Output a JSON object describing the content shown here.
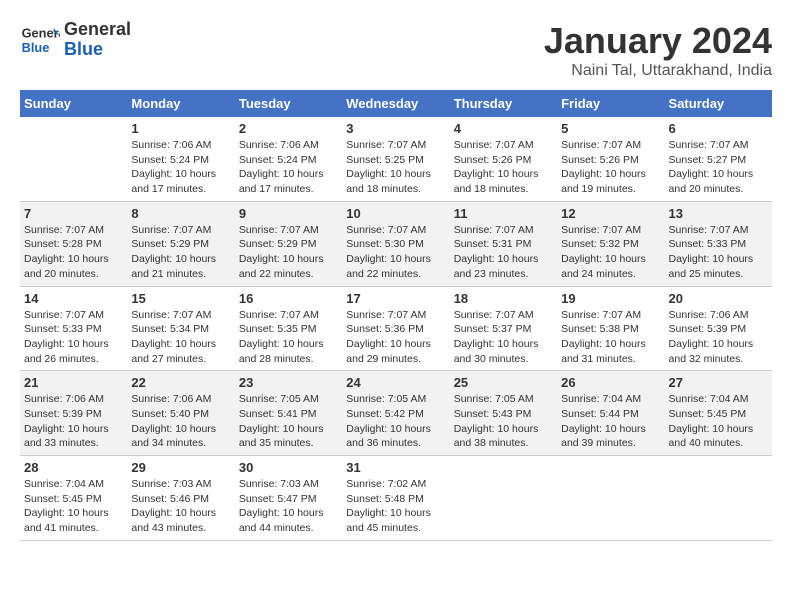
{
  "header": {
    "logo_line1": "General",
    "logo_line2": "Blue",
    "month": "January 2024",
    "location": "Naini Tal, Uttarakhand, India"
  },
  "weekdays": [
    "Sunday",
    "Monday",
    "Tuesday",
    "Wednesday",
    "Thursday",
    "Friday",
    "Saturday"
  ],
  "weeks": [
    [
      {
        "day": "",
        "info": ""
      },
      {
        "day": "1",
        "info": "Sunrise: 7:06 AM\nSunset: 5:24 PM\nDaylight: 10 hours\nand 17 minutes."
      },
      {
        "day": "2",
        "info": "Sunrise: 7:06 AM\nSunset: 5:24 PM\nDaylight: 10 hours\nand 17 minutes."
      },
      {
        "day": "3",
        "info": "Sunrise: 7:07 AM\nSunset: 5:25 PM\nDaylight: 10 hours\nand 18 minutes."
      },
      {
        "day": "4",
        "info": "Sunrise: 7:07 AM\nSunset: 5:26 PM\nDaylight: 10 hours\nand 18 minutes."
      },
      {
        "day": "5",
        "info": "Sunrise: 7:07 AM\nSunset: 5:26 PM\nDaylight: 10 hours\nand 19 minutes."
      },
      {
        "day": "6",
        "info": "Sunrise: 7:07 AM\nSunset: 5:27 PM\nDaylight: 10 hours\nand 20 minutes."
      }
    ],
    [
      {
        "day": "7",
        "info": "Sunrise: 7:07 AM\nSunset: 5:28 PM\nDaylight: 10 hours\nand 20 minutes."
      },
      {
        "day": "8",
        "info": "Sunrise: 7:07 AM\nSunset: 5:29 PM\nDaylight: 10 hours\nand 21 minutes."
      },
      {
        "day": "9",
        "info": "Sunrise: 7:07 AM\nSunset: 5:29 PM\nDaylight: 10 hours\nand 22 minutes."
      },
      {
        "day": "10",
        "info": "Sunrise: 7:07 AM\nSunset: 5:30 PM\nDaylight: 10 hours\nand 22 minutes."
      },
      {
        "day": "11",
        "info": "Sunrise: 7:07 AM\nSunset: 5:31 PM\nDaylight: 10 hours\nand 23 minutes."
      },
      {
        "day": "12",
        "info": "Sunrise: 7:07 AM\nSunset: 5:32 PM\nDaylight: 10 hours\nand 24 minutes."
      },
      {
        "day": "13",
        "info": "Sunrise: 7:07 AM\nSunset: 5:33 PM\nDaylight: 10 hours\nand 25 minutes."
      }
    ],
    [
      {
        "day": "14",
        "info": "Sunrise: 7:07 AM\nSunset: 5:33 PM\nDaylight: 10 hours\nand 26 minutes."
      },
      {
        "day": "15",
        "info": "Sunrise: 7:07 AM\nSunset: 5:34 PM\nDaylight: 10 hours\nand 27 minutes."
      },
      {
        "day": "16",
        "info": "Sunrise: 7:07 AM\nSunset: 5:35 PM\nDaylight: 10 hours\nand 28 minutes."
      },
      {
        "day": "17",
        "info": "Sunrise: 7:07 AM\nSunset: 5:36 PM\nDaylight: 10 hours\nand 29 minutes."
      },
      {
        "day": "18",
        "info": "Sunrise: 7:07 AM\nSunset: 5:37 PM\nDaylight: 10 hours\nand 30 minutes."
      },
      {
        "day": "19",
        "info": "Sunrise: 7:07 AM\nSunset: 5:38 PM\nDaylight: 10 hours\nand 31 minutes."
      },
      {
        "day": "20",
        "info": "Sunrise: 7:06 AM\nSunset: 5:39 PM\nDaylight: 10 hours\nand 32 minutes."
      }
    ],
    [
      {
        "day": "21",
        "info": "Sunrise: 7:06 AM\nSunset: 5:39 PM\nDaylight: 10 hours\nand 33 minutes."
      },
      {
        "day": "22",
        "info": "Sunrise: 7:06 AM\nSunset: 5:40 PM\nDaylight: 10 hours\nand 34 minutes."
      },
      {
        "day": "23",
        "info": "Sunrise: 7:05 AM\nSunset: 5:41 PM\nDaylight: 10 hours\nand 35 minutes."
      },
      {
        "day": "24",
        "info": "Sunrise: 7:05 AM\nSunset: 5:42 PM\nDaylight: 10 hours\nand 36 minutes."
      },
      {
        "day": "25",
        "info": "Sunrise: 7:05 AM\nSunset: 5:43 PM\nDaylight: 10 hours\nand 38 minutes."
      },
      {
        "day": "26",
        "info": "Sunrise: 7:04 AM\nSunset: 5:44 PM\nDaylight: 10 hours\nand 39 minutes."
      },
      {
        "day": "27",
        "info": "Sunrise: 7:04 AM\nSunset: 5:45 PM\nDaylight: 10 hours\nand 40 minutes."
      }
    ],
    [
      {
        "day": "28",
        "info": "Sunrise: 7:04 AM\nSunset: 5:45 PM\nDaylight: 10 hours\nand 41 minutes."
      },
      {
        "day": "29",
        "info": "Sunrise: 7:03 AM\nSunset: 5:46 PM\nDaylight: 10 hours\nand 43 minutes."
      },
      {
        "day": "30",
        "info": "Sunrise: 7:03 AM\nSunset: 5:47 PM\nDaylight: 10 hours\nand 44 minutes."
      },
      {
        "day": "31",
        "info": "Sunrise: 7:02 AM\nSunset: 5:48 PM\nDaylight: 10 hours\nand 45 minutes."
      },
      {
        "day": "",
        "info": ""
      },
      {
        "day": "",
        "info": ""
      },
      {
        "day": "",
        "info": ""
      }
    ]
  ]
}
